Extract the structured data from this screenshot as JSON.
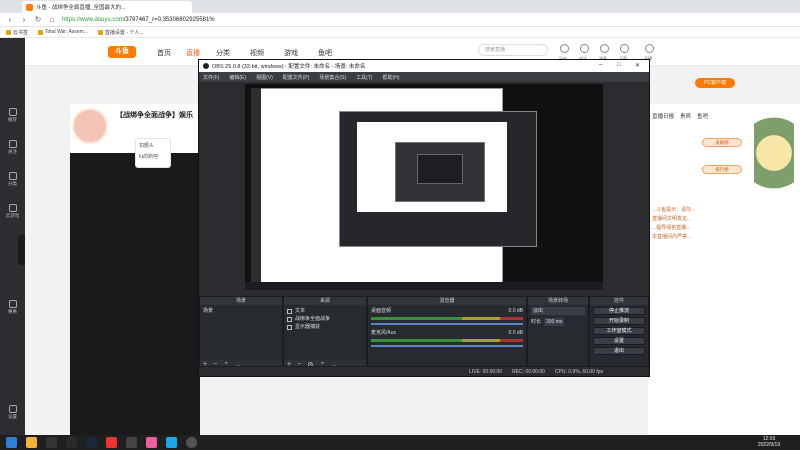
{
  "browser": {
    "tab_title": "斗鱼 - 战绑争全面直播_全国最大的...",
    "url_host": "https://www.douyu.com",
    "url_path": "/3797467_r=0.35306802925581%",
    "bookmarks": [
      "云书签",
      "Total War: Assem...",
      "直播设置 - 个人..."
    ]
  },
  "site": {
    "logo": "斗鱼",
    "nav": [
      "首页",
      "直播",
      "分类",
      "视频",
      "游戏",
      "鱼吧"
    ],
    "search_placeholder": "搜索直播",
    "header_icons": [
      "历史",
      "关注",
      "消息",
      "下载",
      "开播"
    ],
    "room_title": "【战绑争全面战争】娱乐",
    "dropdown": [
      "扣额头",
      "fu的新吧"
    ],
    "chat_tabs": [
      "直播日报",
      "贵宾",
      "鱼吧"
    ],
    "chat_lines": [
      "...斗鱼提示：请勿...",
      "直播间文明发言...",
      "...倡导绿色直播...",
      "本直播间内严禁..."
    ],
    "gifts": [
      "贡献榜",
      "排行榜"
    ],
    "pc_button": "PC客户端",
    "sidebar": [
      "推荐",
      "关注",
      "分类",
      "云游戏",
      "赛事",
      "设置"
    ]
  },
  "obs": {
    "title": "OBS 25.0.8 (32-bit, windows) - 配置文件: 未命名 - 场景: 未命名",
    "menu": [
      "文件(F)",
      "编辑(E)",
      "视图(V)",
      "配置文件(P)",
      "场景集合(S)",
      "工具(T)",
      "帮助(H)"
    ],
    "docks": {
      "scenes": {
        "title": "场景",
        "items": [
          "场景"
        ]
      },
      "sources": {
        "title": "来源",
        "items": [
          "文本",
          "战绑争全面战争",
          "显示器捕获"
        ]
      },
      "mixer": {
        "title": "混音器",
        "channels": [
          {
            "name": "桌面音频",
            "db": "0.0 dB"
          },
          {
            "name": "麦克风/Aux",
            "db": "0.0 dB"
          }
        ]
      },
      "transitions": {
        "title": "场景转场",
        "type": "淡出",
        "duration_label": "时长",
        "duration": "300 ms"
      },
      "controls": {
        "title": "控件",
        "buttons": [
          "停止推流",
          "开始录制",
          "工作室模式",
          "设置",
          "退出"
        ]
      }
    },
    "status": [
      "LIVE: 00:00:00",
      "REC: 00:00:00",
      "CPU: 0.9%, 60.00 fps"
    ]
  },
  "taskbar": {
    "time": "12:59",
    "date": "2022/9/19"
  }
}
